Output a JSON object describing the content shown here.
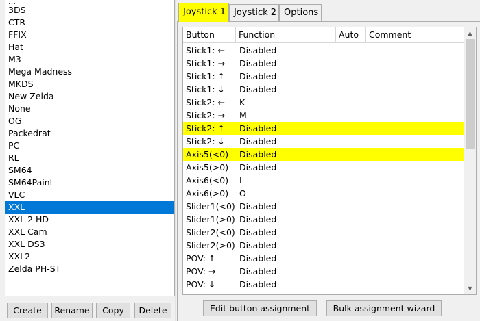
{
  "profiles": {
    "top_partial": "…",
    "items": [
      "3DS",
      "CTR",
      "FFIX",
      "Hat",
      "M3",
      "Mega Madness",
      "MKDS",
      "New Zelda",
      "None",
      "OG",
      "Packedrat",
      "PC",
      "RL",
      "SM64",
      "SM64Paint",
      "VLC",
      "XXL",
      "XXL 2 HD",
      "XXL Cam",
      "XXL DS3",
      "XXL2",
      "Zelda PH-ST"
    ],
    "selected": "XXL"
  },
  "buttons": {
    "create": "Create",
    "rename": "Rename",
    "copy": "Copy",
    "delete": "Delete",
    "edit_assignment": "Edit button assignment",
    "bulk_wizard": "Bulk assignment wizard"
  },
  "tabs": {
    "joystick1": "Joystick 1",
    "joystick2": "Joystick 2",
    "options": "Options",
    "active": "Joystick 1"
  },
  "grid": {
    "headers": {
      "button": "Button",
      "function": "Function",
      "auto": "Auto",
      "comment": "Comment"
    },
    "rows": [
      {
        "button": "Stick1: ←",
        "function": "Disabled",
        "auto": "---",
        "highlight": false
      },
      {
        "button": "Stick1: →",
        "function": "Disabled",
        "auto": "---",
        "highlight": false
      },
      {
        "button": "Stick1: ↑",
        "function": "Disabled",
        "auto": "---",
        "highlight": false
      },
      {
        "button": "Stick1: ↓",
        "function": "Disabled",
        "auto": "---",
        "highlight": false
      },
      {
        "button": "Stick2: ←",
        "function": "K",
        "auto": "---",
        "highlight": false
      },
      {
        "button": "Stick2: →",
        "function": "M",
        "auto": "---",
        "highlight": false
      },
      {
        "button": "Stick2: ↑",
        "function": "Disabled",
        "auto": "---",
        "highlight": true
      },
      {
        "button": "Stick2: ↓",
        "function": "Disabled",
        "auto": "---",
        "highlight": false
      },
      {
        "button": "Axis5(<0)",
        "function": "Disabled",
        "auto": "---",
        "highlight": true
      },
      {
        "button": "Axis5(>0)",
        "function": "Disabled",
        "auto": "---",
        "highlight": false
      },
      {
        "button": "Axis6(<0)",
        "function": "I",
        "auto": "---",
        "highlight": false
      },
      {
        "button": "Axis6(>0)",
        "function": "O",
        "auto": "---",
        "highlight": false
      },
      {
        "button": "Slider1(<0)",
        "function": "Disabled",
        "auto": "---",
        "highlight": false
      },
      {
        "button": "Slider1(>0)",
        "function": "Disabled",
        "auto": "---",
        "highlight": false
      },
      {
        "button": "Slider2(<0)",
        "function": "Disabled",
        "auto": "---",
        "highlight": false
      },
      {
        "button": "Slider2(>0)",
        "function": "Disabled",
        "auto": "---",
        "highlight": false
      },
      {
        "button": "POV: ↑",
        "function": "Disabled",
        "auto": "---",
        "highlight": false
      },
      {
        "button": "POV: →",
        "function": "Disabled",
        "auto": "---",
        "highlight": false
      },
      {
        "button": "POV: ↓",
        "function": "Disabled",
        "auto": "---",
        "highlight": false
      }
    ]
  },
  "colors": {
    "highlight": "#ffff00",
    "selection": "#0078d7"
  }
}
